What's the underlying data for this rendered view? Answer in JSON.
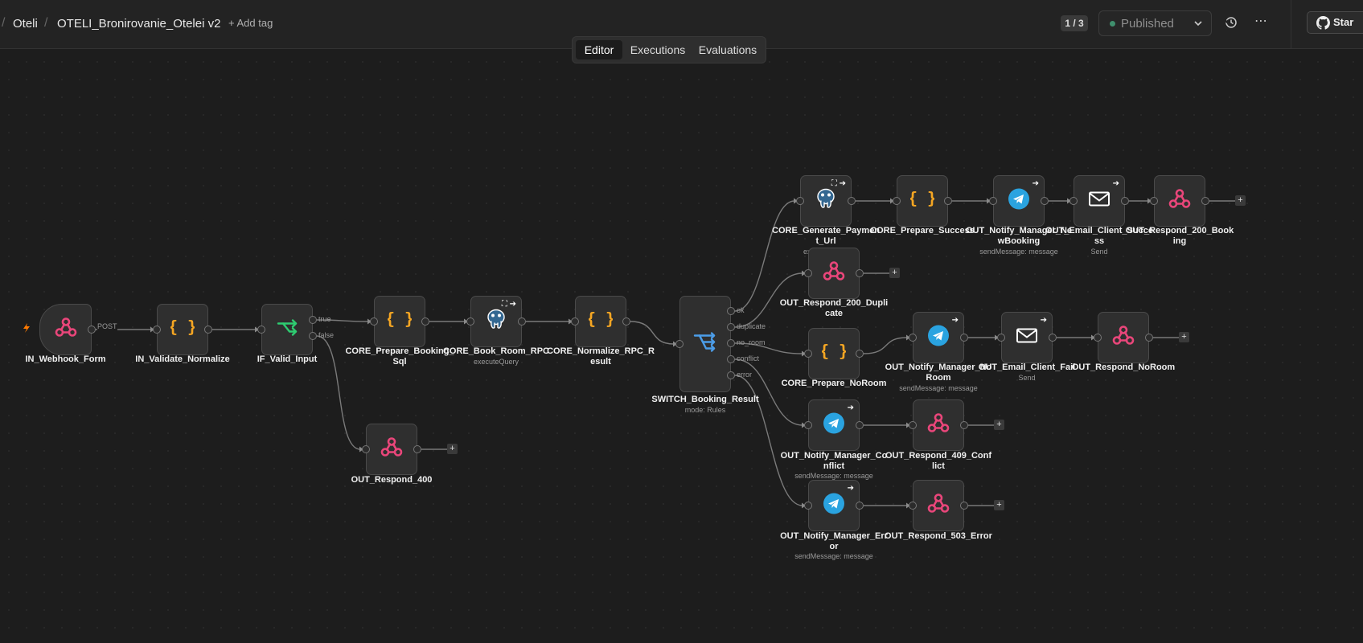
{
  "header": {
    "breadcrumb_project": "Oteli",
    "breadcrumb_sep": "/",
    "workflow_name": "OTELI_Bronirovanie_Otelei v2",
    "add_tag": "+ Add tag",
    "version_counter": "1 / 3",
    "publish_label": "Published",
    "star_label": "Star"
  },
  "tabs": [
    "Editor",
    "Executions",
    "Evaluations"
  ],
  "active_tab": "Editor",
  "colors": {
    "canvas_bg": "#1d1d1d",
    "webhook": "#e9467a",
    "code": "#f5a623",
    "if_green": "#2ecc71",
    "switch_blue": "#4c9de8",
    "telegram": "#2aa3e0",
    "trigger": "#ff7a00"
  },
  "nodes": [
    {
      "id": "webhook",
      "title": "IN_Webhook_Form",
      "sub": "",
      "icon": "webhook-icon"
    },
    {
      "id": "validate",
      "title": "IN_Validate_Normalize",
      "sub": "",
      "icon": "code-icon"
    },
    {
      "id": "if",
      "title": "IF_Valid_Input",
      "sub": "",
      "icon": "if-icon"
    },
    {
      "id": "prep_sql",
      "title": "CORE_Prepare_Booking_ Sql",
      "sub": "",
      "icon": "code-icon"
    },
    {
      "id": "book_rpc",
      "title": "CORE_Book_Room_RPC",
      "sub": "executeQuery",
      "icon": "postgres-icon"
    },
    {
      "id": "norm_rpc",
      "title": "CORE_Normalize_RPC_R esult",
      "sub": "",
      "icon": "code-icon"
    },
    {
      "id": "switch",
      "title": "SWITCH_Booking_Result",
      "sub": "mode: Rules",
      "icon": "switch-icon"
    },
    {
      "id": "resp400",
      "title": "OUT_Respond_400",
      "sub": "",
      "icon": "webhook-icon"
    },
    {
      "id": "gen_pay",
      "title": "CORE_Generate_Paymen t_Url",
      "sub": "executeQuery",
      "icon": "postgres-icon"
    },
    {
      "id": "prep_succ",
      "title": "CORE_Prepare_Success",
      "sub": "",
      "icon": "code-icon"
    },
    {
      "id": "notify_new",
      "title": "OUT_Notify_Manager_Ne wBooking",
      "sub": "sendMessage: message",
      "icon": "telegram-icon"
    },
    {
      "id": "email_succ",
      "title": "OUT_Email_Client_Succe ss",
      "sub": "Send",
      "icon": "mail-icon"
    },
    {
      "id": "resp200",
      "title": "OUT_Respond_200_Book ing",
      "sub": "",
      "icon": "webhook-icon"
    },
    {
      "id": "resp200dup",
      "title": "OUT_Respond_200_Dupli cate",
      "sub": "",
      "icon": "webhook-icon"
    },
    {
      "id": "prep_noroom",
      "title": "CORE_Prepare_NoRoom",
      "sub": "",
      "icon": "code-icon"
    },
    {
      "id": "notify_noroom",
      "title": "OUT_Notify_Manager_No Room",
      "sub": "sendMessage: message",
      "icon": "telegram-icon"
    },
    {
      "id": "email_fail",
      "title": "OUT_Email_Client_Fail",
      "sub": "Send",
      "icon": "mail-icon"
    },
    {
      "id": "resp_noroom",
      "title": "OUT_Respond_NoRoom",
      "sub": "",
      "icon": "webhook-icon"
    },
    {
      "id": "notify_conf",
      "title": "OUT_Notify_Manager_Co nflict",
      "sub": "sendMessage: message",
      "icon": "telegram-icon"
    },
    {
      "id": "resp409",
      "title": "OUT_Respond_409_Conf lict",
      "sub": "",
      "icon": "webhook-icon"
    },
    {
      "id": "notify_err",
      "title": "OUT_Notify_Manager_Err or",
      "sub": "sendMessage: message",
      "icon": "telegram-icon"
    },
    {
      "id": "resp503",
      "title": "OUT_Respond_503_Error",
      "sub": "",
      "icon": "webhook-icon"
    }
  ],
  "port_labels": {
    "post": "POST",
    "true": "true",
    "false": "false",
    "ok": "ok",
    "duplicate": "duplicate",
    "no_room": "no_room",
    "conflict": "conflict",
    "error": "error"
  },
  "plus_label": "+"
}
